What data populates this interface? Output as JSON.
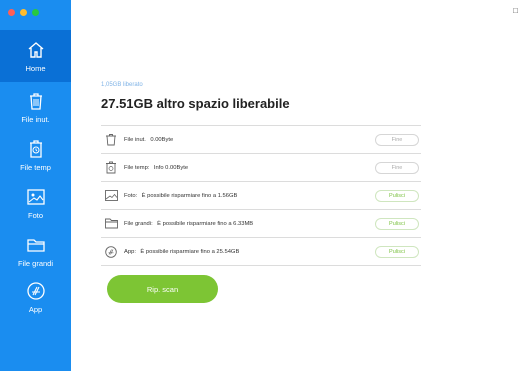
{
  "window": {
    "control_icon": "window-icon"
  },
  "sidebar": {
    "items": [
      {
        "label": "Home",
        "icon": "home-icon",
        "active": true
      },
      {
        "label": "File inut.",
        "icon": "trash-icon"
      },
      {
        "label": "File temp",
        "icon": "temp-file-icon"
      },
      {
        "label": "Foto",
        "icon": "photo-icon"
      },
      {
        "label": "File grandi",
        "icon": "folder-icon"
      },
      {
        "label": "App",
        "icon": "app-store-icon"
      }
    ]
  },
  "main": {
    "subtitle": "1,05GB liberato",
    "title": "27.51GB altro spazio liberabile",
    "rows": [
      {
        "name": "File inut.",
        "detail": "0.00Byte",
        "button": "Fine",
        "button_state": "disabled"
      },
      {
        "name": "File temp:",
        "detail": "Info 0.00Byte",
        "button": "Fine",
        "button_state": "disabled"
      },
      {
        "name": "Foto:",
        "detail": "È possibile risparmiare fino a 1.56GB",
        "button": "Pulisci",
        "button_state": "enabled"
      },
      {
        "name": "File grandi:",
        "detail": "È possibile risparmiare fino a 6.33MB",
        "button": "Pulisci",
        "button_state": "enabled"
      },
      {
        "name": "App:",
        "detail": "È possibile risparmiare fino a 25.54GB",
        "button": "Pulisci",
        "button_state": "enabled"
      }
    ],
    "scan_button": "Rip. scan"
  },
  "colors": {
    "sidebar": "#1a8df0",
    "sidebar_active": "#0a70d6",
    "accent_green": "#7dc534"
  }
}
